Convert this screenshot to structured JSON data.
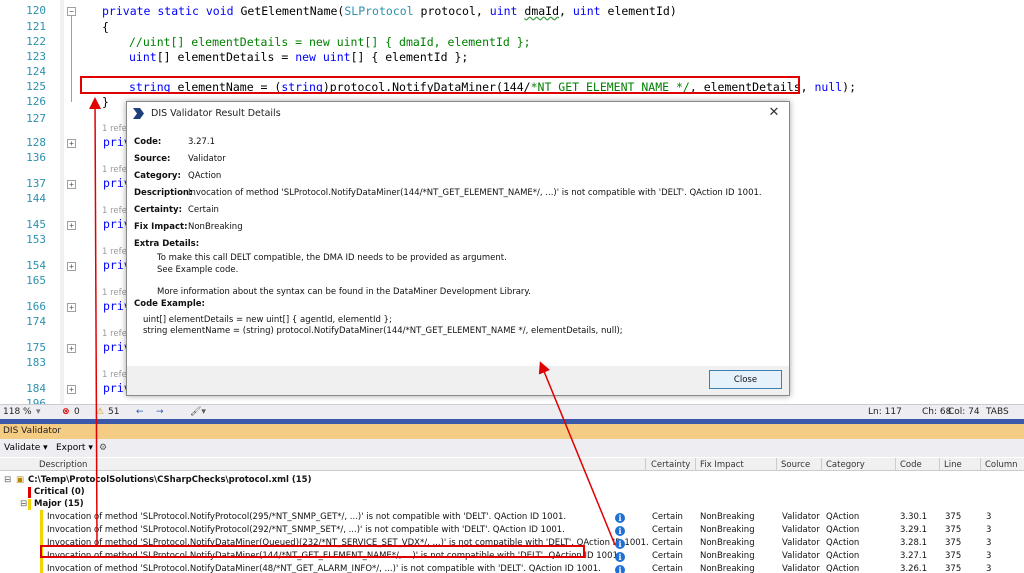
{
  "editor": {
    "line_numbers": [
      "120",
      "121",
      "122",
      "123",
      "124",
      "125",
      "126",
      "127",
      "128",
      "136",
      "137",
      "144",
      "145",
      "153",
      "154",
      "165",
      "166",
      "174",
      "175",
      "183",
      "184",
      "196"
    ],
    "code_line_1_kw": "private static void",
    "code_line_1_name": " GetElementName(",
    "code_line_1_type": "SLProtocol",
    "code_line_1_mid": " protocol, ",
    "code_line_1_uint": "uint",
    "code_line_1_param": "dmaId",
    "code_line_1_end": ", ",
    "code_line_1_uint2": "uint",
    "code_line_1_tail": " elementId)",
    "code_line_2": "{",
    "code_line_3": "//uint[] elementDetails = new uint[] { dmaId, elementId };",
    "code_line_4_a": "uint",
    "code_line_4_b": "[] elementDetails = ",
    "code_line_4_c": "new",
    "code_line_4_d": " ",
    "code_line_4_e": "uint",
    "code_line_4_f": "[] { elementId };",
    "code_line_6_a": "string",
    "code_line_6_b": " elementName = (",
    "code_line_6_c": "string",
    "code_line_6_d": ")protocol.NotifyDataMiner(144/",
    "code_line_6_e": "*NT_GET_ELEMENT_NAME */",
    "code_line_6_f": ", elementDetails, ",
    "code_line_6_g": "null",
    "code_line_6_h": ");",
    "code_line_7": "}",
    "refs_label": "1 refer",
    "private_label": "priv"
  },
  "statusbar": {
    "zoom": "118 %",
    "errors": "0",
    "warnings": "51",
    "ln": "Ln: 117",
    "ch": "Ch: 68",
    "col": "Col: 74",
    "tabs": "TABS"
  },
  "panel": {
    "title": "DIS Validator",
    "toolbar": {
      "validate": "Validate",
      "export": "Export"
    },
    "columns": [
      "Description",
      "Certainty",
      "Fix Impact",
      "Source",
      "Category",
      "Code",
      "Line",
      "Column"
    ],
    "root": "C:\\Temp\\ProtocolSolutions\\CSharpChecks\\protocol.xml (15)",
    "critical": "Critical (0)",
    "major": "Major (15)",
    "rows": [
      {
        "desc": "Invocation of method 'SLProtocol.NotifyProtocol(295/*NT_SNMP_GET*/, ...)' is not compatible with 'DELT'. QAction ID 1001.",
        "certainty": "Certain",
        "fix": "NonBreaking",
        "source": "Validator",
        "category": "QAction",
        "code": "3.30.1",
        "line": "375",
        "column": "3"
      },
      {
        "desc": "Invocation of method 'SLProtocol.NotifyProtocol(292/*NT_SNMP_SET*/, ...)' is not compatible with 'DELT'. QAction ID 1001.",
        "certainty": "Certain",
        "fix": "NonBreaking",
        "source": "Validator",
        "category": "QAction",
        "code": "3.29.1",
        "line": "375",
        "column": "3"
      },
      {
        "desc": "Invocation of method 'SLProtocol.NotifyDataMiner(Queued)(232/*NT_SERVICE_SET_VDX*/, ...)' is not compatible with 'DELT'. QAction ID 1001.",
        "certainty": "Certain",
        "fix": "NonBreaking",
        "source": "Validator",
        "category": "QAction",
        "code": "3.28.1",
        "line": "375",
        "column": "3"
      },
      {
        "desc": "Invocation of method 'SLProtocol.NotifyDataMiner(144/*NT_GET_ELEMENT_NAME*/, ...)' is not compatible with 'DELT'. QAction ID 1001.",
        "certainty": "Certain",
        "fix": "NonBreaking",
        "source": "Validator",
        "category": "QAction",
        "code": "3.27.1",
        "line": "375",
        "column": "3"
      },
      {
        "desc": "Invocation of method 'SLProtocol.NotifyDataMiner(48/*NT_GET_ALARM_INFO*/, ...)' is not compatible with 'DELT'. QAction ID 1001.",
        "certainty": "Certain",
        "fix": "NonBreaking",
        "source": "Validator",
        "category": "QAction",
        "code": "3.26.1",
        "line": "375",
        "column": "3"
      }
    ]
  },
  "dialog": {
    "title": "DIS Validator Result Details",
    "code_label": "Code:",
    "code": "3.27.1",
    "source_label": "Source:",
    "source": "Validator",
    "category_label": "Category:",
    "category": "QAction",
    "description_label": "Description:",
    "description": "Invocation of method 'SLProtocol.NotifyDataMiner(144/*NT_GET_ELEMENT_NAME*/, ...)' is not compatible with 'DELT'. QAction ID 1001.",
    "certainty_label": "Certainty:",
    "certainty": "Certain",
    "fix_label": "Fix Impact:",
    "fix": "NonBreaking",
    "extra_label": "Extra Details:",
    "extra_1": "To make this call DELT compatible, the DMA ID needs to be provided as argument.",
    "extra_2": "See Example code.",
    "extra_3": "More information about the syntax can be found in the DataMiner Development Library.",
    "code_example_label": "Code Example:",
    "code_ex_1": "uint[] elementDetails = new uint[] { agentId, elementId };",
    "code_ex_2": "string elementName = (string) protocol.NotifyDataMiner(144/*NT_GET_ELEMENT_NAME */, elementDetails, null);",
    "close": "Close"
  },
  "colors": {
    "accent_red": "#e00000",
    "panel_title": "#f5cc84",
    "critical": "#e00000",
    "major": "#f2d500"
  }
}
